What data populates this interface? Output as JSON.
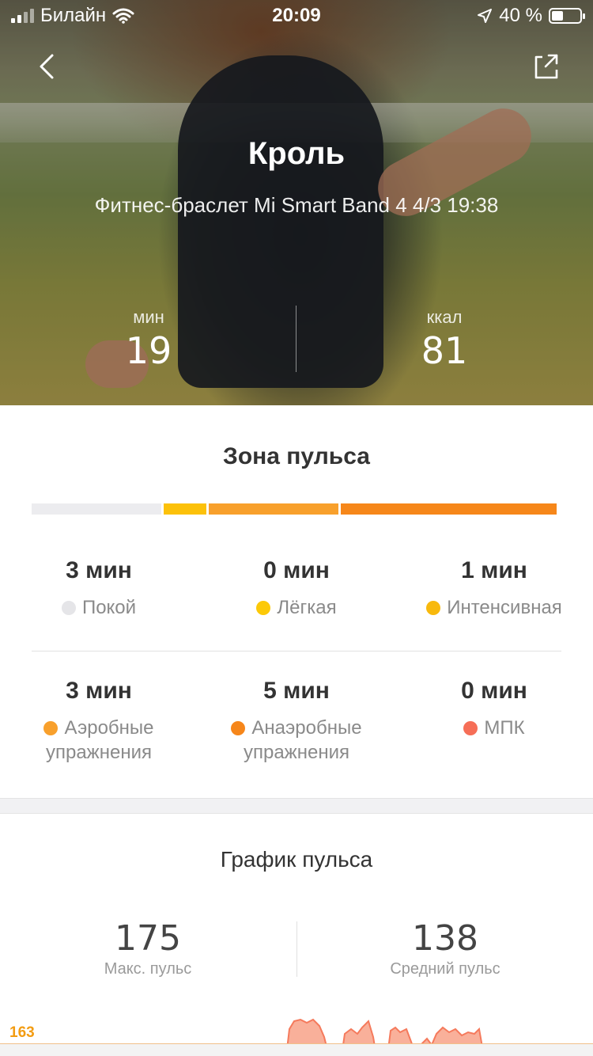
{
  "status_bar": {
    "carrier": "Билайн",
    "time": "20:09",
    "battery": "40 %"
  },
  "hero": {
    "title": "Кроль",
    "subtitle": "Фитнес-браслет Mi Smart Band 4 4/3 19:38",
    "duration": {
      "unit": "мин",
      "value": "19"
    },
    "calories": {
      "unit": "ккал",
      "value": "81"
    }
  },
  "zones": {
    "title": "Зона пульса",
    "colors": {
      "rest": "#ececef",
      "light": "#fcc10a",
      "intensive": "#f8b20f",
      "aerobic": "#f8a02c",
      "anaerobic": "#f6871a",
      "vo2max": "#f56d55"
    },
    "items": [
      {
        "value": "3 мин",
        "label": "Покой",
        "color": "#e5e5e8"
      },
      {
        "value": "0 мин",
        "label": "Лёгкая",
        "color": "#fcc908"
      },
      {
        "value": "1 мин",
        "label": "Интенсивная",
        "color": "#f8b90d"
      },
      {
        "value": "3 мин",
        "label1": "Аэробные",
        "label2": "упражнения",
        "color": "#f8a02c"
      },
      {
        "value": "5 мин",
        "label1": "Анаэробные",
        "label2": "упражнения",
        "color": "#f6861a"
      },
      {
        "value": "0 мин",
        "label": "МПК",
        "color": "#f66e57"
      }
    ]
  },
  "heart_rate": {
    "title": "График пульса",
    "max": {
      "value": "175",
      "label": "Макс. пульс"
    },
    "avg": {
      "value": "138",
      "label": "Средний пульс"
    },
    "reference_line": "163"
  }
}
